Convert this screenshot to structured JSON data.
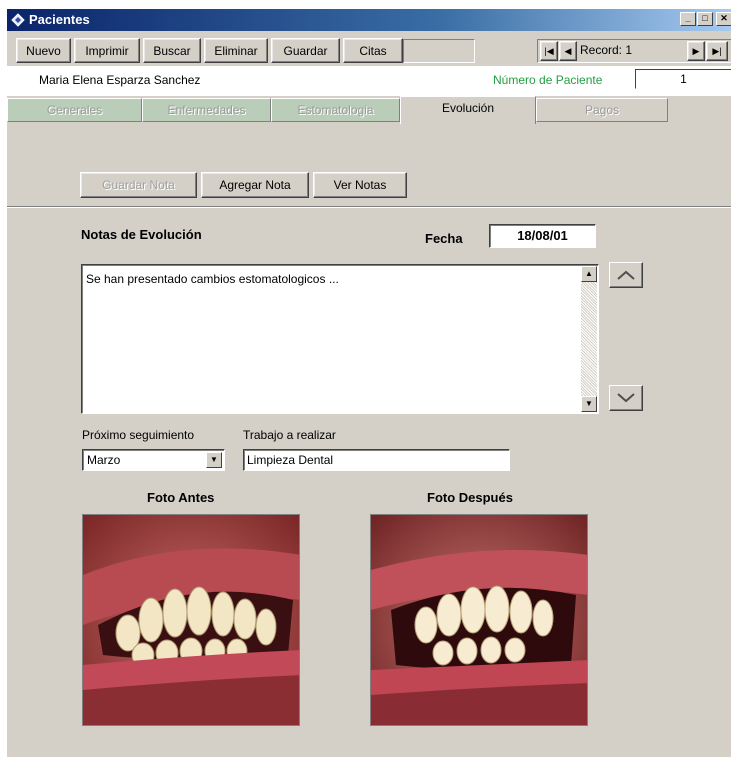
{
  "window": {
    "title": "Pacientes"
  },
  "toolbar": {
    "buttons": [
      "Nuevo",
      "Imprimir",
      "Buscar",
      "Eliminar",
      "Guardar",
      "Citas"
    ],
    "record_label": "Record: 1"
  },
  "patient": {
    "name": "Maria Elena Esparza Sanchez",
    "number_label": "Número de Paciente",
    "number": "1"
  },
  "tabs": [
    "Generales",
    "Enfermedades",
    "Estomatologia",
    "Evolución",
    "Pagos"
  ],
  "active_tab": "Evolución",
  "note_actions": [
    "Guardar Nota",
    "Agregar Nota",
    "Ver Notas"
  ],
  "notes": {
    "heading": "Notas de Evolución",
    "date_label": "Fecha",
    "date": "18/08/01",
    "text": "Se han presentado cambios estomatologicos ..."
  },
  "followup": {
    "next_label": "Próximo seguimiento",
    "next_value": "Marzo",
    "work_label": "Trabajo a realizar",
    "work_value": "Limpieza Dental"
  },
  "photos": {
    "before_label": "Foto Antes",
    "after_label": "Foto Después"
  },
  "icons": {
    "app": "app-icon",
    "minimize": "minimize-icon",
    "maximize": "maximize-icon",
    "close": "close-icon",
    "first": "first-record-icon",
    "prev": "previous-record-icon",
    "next": "next-record-icon",
    "last": "last-record-icon",
    "up": "chevron-up-icon",
    "down": "chevron-down-icon"
  }
}
